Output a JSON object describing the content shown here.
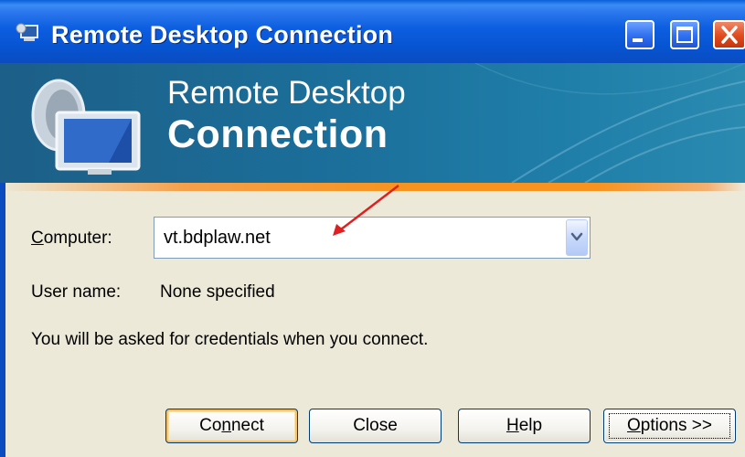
{
  "window": {
    "title": "Remote Desktop Connection",
    "accent_color": "#0a5fd8"
  },
  "titlebar_buttons": [
    "minimize-icon",
    "maximize-icon",
    "close-icon"
  ],
  "banner": {
    "line1": "Remote Desktop",
    "line2": "Connection",
    "icon": "remote-desktop-monitor-icon"
  },
  "form": {
    "computer_label_first": "C",
    "computer_label_rest": "omputer:",
    "computer_value": "vt.bdplaw.net",
    "username_label": "User name:",
    "username_value": "None specified",
    "info_text": "You will be asked for credentials when you connect."
  },
  "buttons": {
    "connect_pre": "Co",
    "connect_u": "n",
    "connect_post": "nect",
    "close": "Close",
    "help_u": "H",
    "help_post": "elp",
    "options_u": "O",
    "options_post": "ptions >>"
  },
  "annotation_color": "#e02020"
}
